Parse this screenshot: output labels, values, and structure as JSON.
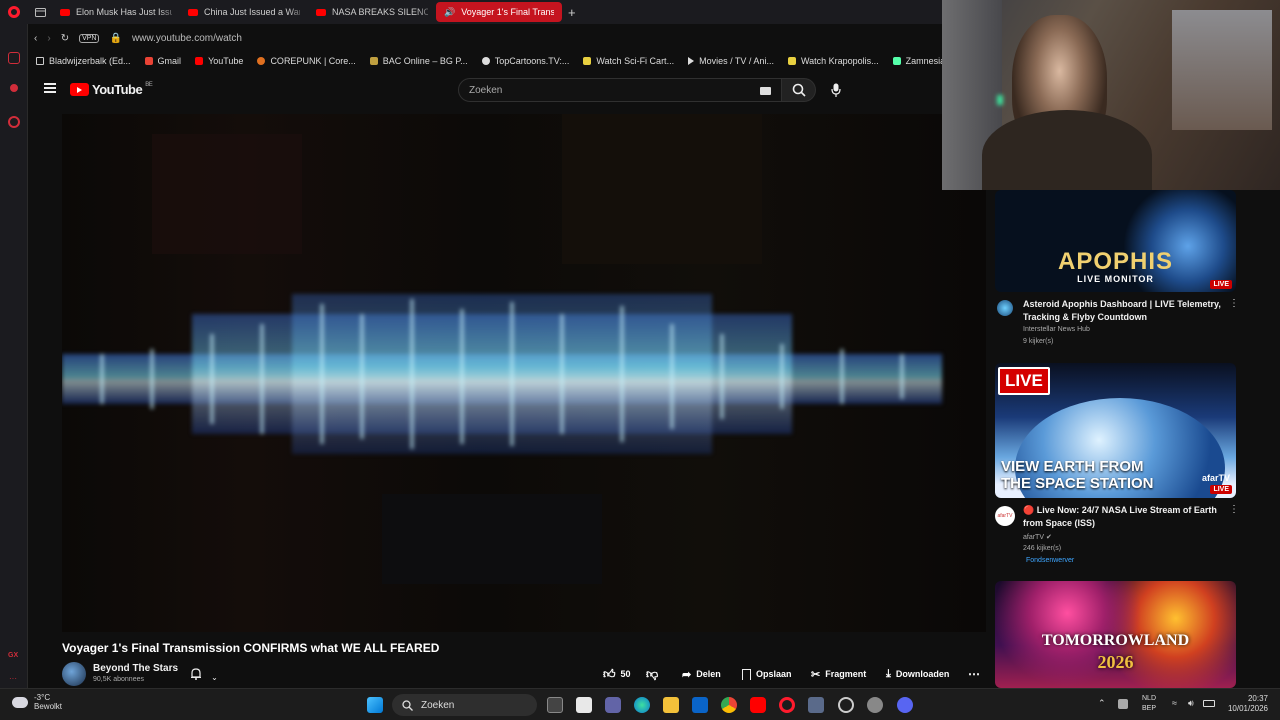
{
  "browser": {
    "tabs": [
      {
        "label": "Elon Musk Has Just Issued"
      },
      {
        "label": "China Just Issued a Warni"
      },
      {
        "label": "NASA BREAKS SILENCE o"
      },
      {
        "label": "Voyager 1's Final Trans",
        "active": true
      }
    ],
    "new_tab": "+",
    "vpn": "VPN",
    "url": "www.youtube.com/watch",
    "bookmarks": [
      "Bladwijzerbalk (Ed...",
      "Gmail",
      "YouTube",
      "COREPUNK | Core...",
      "BAC Online – BG P...",
      "TopCartoons.TV:...",
      "Watch Sci-Fi Cart...",
      "Movies / TV / Ani...",
      "Watch Krapopolis...",
      "Zamnesia | Het Be"
    ],
    "sidebar_bottom": "GX"
  },
  "youtube": {
    "logo": "YouTube",
    "region": "BE",
    "search_placeholder": "Zoeken"
  },
  "video": {
    "title": "Voyager 1's Final Transmission CONFIRMS what WE ALL FEARED",
    "channel": "Beyond The Stars",
    "subscribers": "90,5K abonnees",
    "likes": "50",
    "actions": {
      "share": "Delen",
      "save": "Opslaan",
      "clip": "Fragment",
      "download": "Downloaden"
    }
  },
  "recommendations": [
    {
      "thumb_title": "APOPHIS",
      "thumb_subtitle": "LIVE MONITOR",
      "badge": "LIVE",
      "title": "Asteroid Apophis Dashboard | LIVE Telemetry, Tracking & Flyby Countdown",
      "channel": "Interstellar News Hub",
      "viewers": "9 kijker(s)"
    },
    {
      "thumb_live": "LIVE",
      "thumb_title": "VIEW EARTH FROM THE SPACE STATION",
      "thumb_brand": "afarTV",
      "badge": "LIVE",
      "avatar_text": "afarTV",
      "title": "🔴 Live Now: 24/7 NASA Live Stream of Earth from Space (ISS)",
      "channel": "afarTV",
      "viewers": "246 kijker(s)",
      "tag": "Fondsenwerver"
    },
    {
      "thumb_title": "TOMORROWLAND",
      "thumb_year": "2026"
    }
  ],
  "taskbar": {
    "weather_temp": "-3°C",
    "weather_desc": "Bewolkt",
    "search": "Zoeken",
    "lang_top": "NLD",
    "lang_bottom": "BEP",
    "time": "20:37",
    "date": "10/01/2026"
  },
  "colors": {
    "accent": "#ff0000",
    "opera": "#ff1b2d",
    "active_tab": "#c5141f",
    "background": "#0f0f0f"
  }
}
